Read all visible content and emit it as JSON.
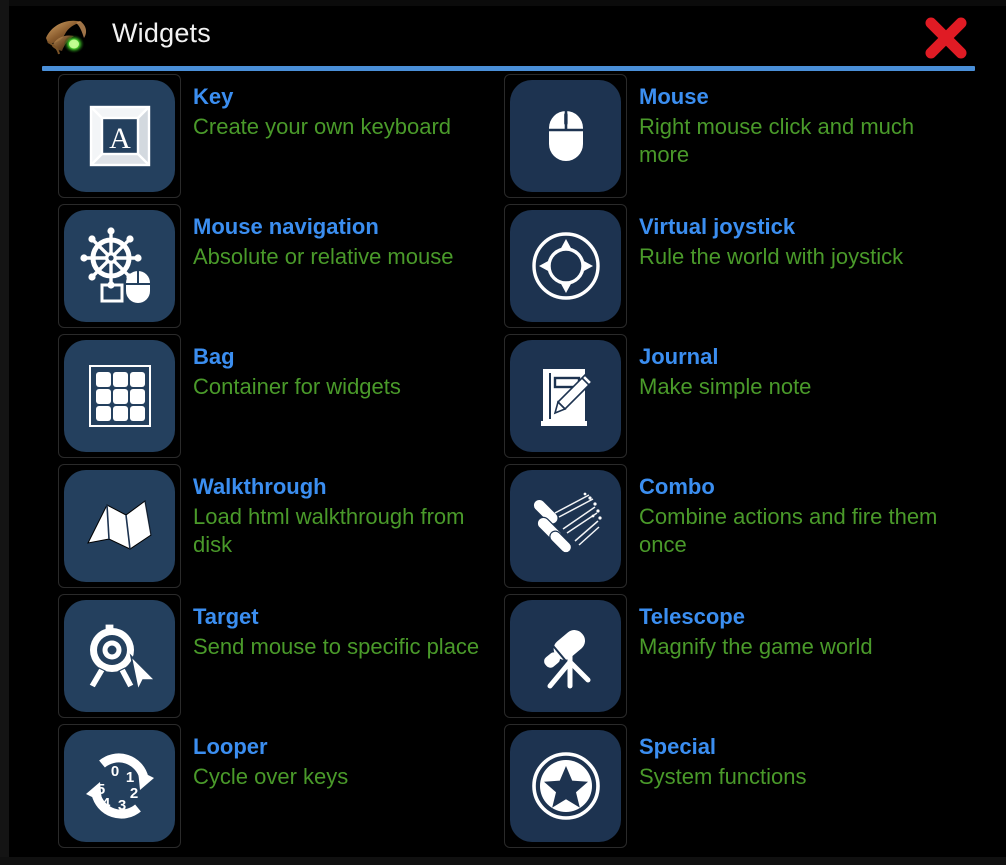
{
  "window": {
    "title": "Widgets",
    "logo_icon": "dragon-logo-icon",
    "close_icon": "close-x-icon",
    "accent_rule_color": "#4a8fd8",
    "close_color": "#e01b24",
    "title_color": "#3b8ef0",
    "description_color": "#4a9a2a",
    "background_color": "#000000",
    "tile_color_left": "#24405e",
    "tile_color_right": "#1d3350"
  },
  "widgets": [
    {
      "title": "Key",
      "description": "Create your own keyboard",
      "icon": "keyboard-key-icon",
      "icon_label": "A"
    },
    {
      "title": "Mouse",
      "description": "Right mouse click and much more",
      "icon": "mouse-icon"
    },
    {
      "title": "Mouse navigation",
      "description": "Absolute or relative mouse",
      "icon": "ships-wheel-mouse-icon"
    },
    {
      "title": "Virtual joystick",
      "description": "Rule the world with joystick",
      "icon": "joystick-dpad-icon"
    },
    {
      "title": "Bag",
      "description": "Container for widgets",
      "icon": "grid-bag-icon"
    },
    {
      "title": "Journal",
      "description": "Make simple note",
      "icon": "notebook-pencil-icon"
    },
    {
      "title": "Walkthrough",
      "description": "Load html walkthrough from disk",
      "icon": "folded-map-icon"
    },
    {
      "title": "Combo",
      "description": "Combine actions and fire them once",
      "icon": "missiles-icon"
    },
    {
      "title": "Target",
      "description": "Send mouse to specific place",
      "icon": "target-cursor-icon"
    },
    {
      "title": "Telescope",
      "description": "Magnify the game world",
      "icon": "telescope-icon"
    },
    {
      "title": "Looper",
      "description": "Cycle over keys",
      "icon": "loop-arrows-icon",
      "icon_numbers": [
        "0",
        "1",
        "2",
        "3",
        "4",
        "5"
      ]
    },
    {
      "title": "Special",
      "description": "System functions",
      "icon": "star-circle-icon"
    }
  ]
}
